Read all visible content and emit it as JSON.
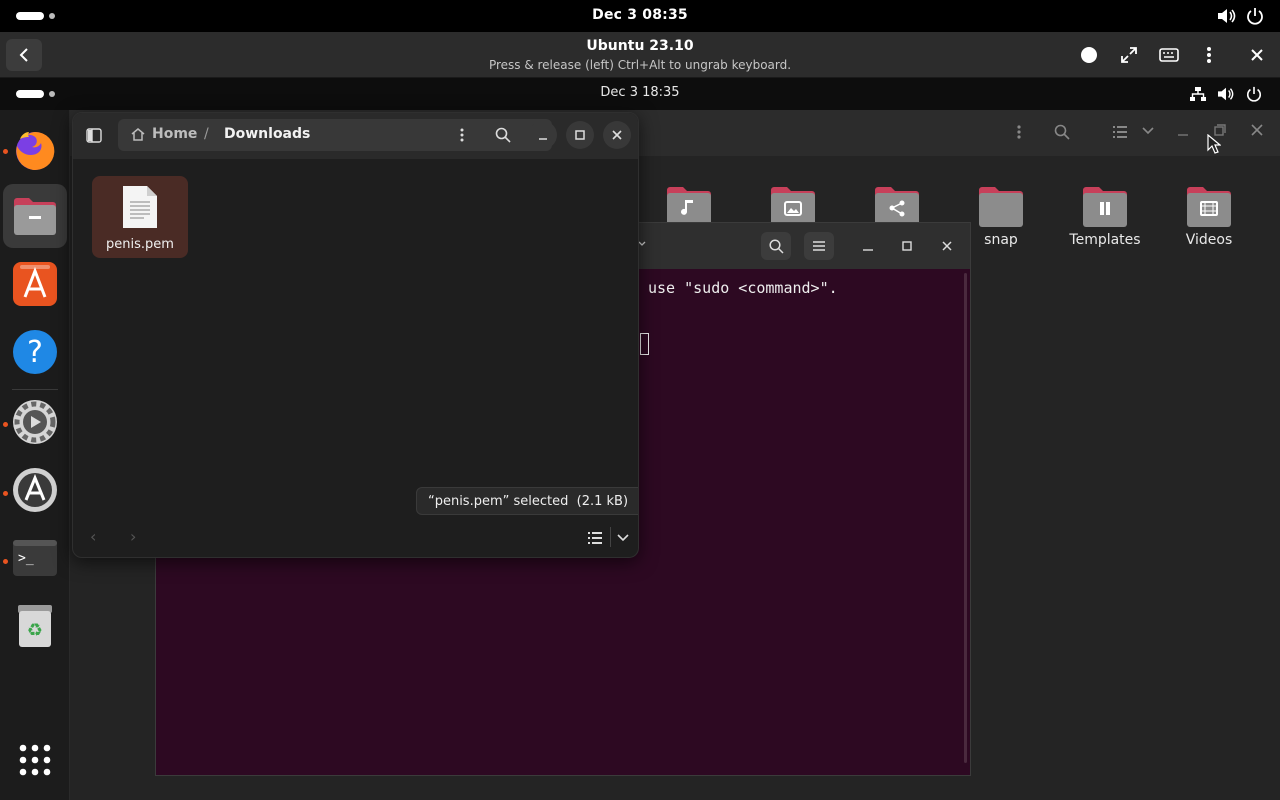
{
  "host": {
    "clock": "Dec 3  08:35"
  },
  "vm_header": {
    "title": "Ubuntu 23.10",
    "subtitle": "Press & release (left) Ctrl+Alt to ungrab keyboard."
  },
  "guest": {
    "clock": "Dec 3  18:35"
  },
  "dock": {
    "items": [
      "Firefox",
      "Files",
      "App Center",
      "Help",
      "Settings",
      "Software Updater",
      "Terminal",
      "Trash",
      "Show Apps"
    ]
  },
  "files_window": {
    "breadcrumb": [
      "Home",
      "/",
      "Downloads"
    ],
    "file_name": "penis.pem",
    "status": "“penis.pem” selected  (2.1 kB)"
  },
  "background_files": {
    "folders": [
      "snap",
      "Templates",
      "Videos"
    ]
  },
  "terminal": {
    "visible_line": "use \"sudo <command>\"."
  },
  "colors": {
    "terminal_bg": "#2d0922",
    "folder_accent": "#c7405a",
    "selection": "#4a2b25",
    "ubuntu_orange": "#e95420"
  }
}
